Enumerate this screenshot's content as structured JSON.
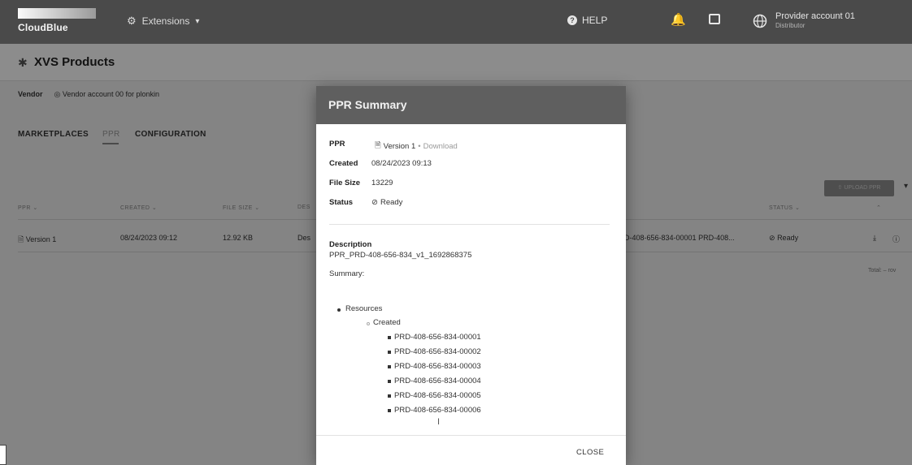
{
  "topbar": {
    "logo_text": "CloudBlue",
    "extensions_label": "Extensions",
    "help_label": "HELP",
    "account_name": "Provider account 01",
    "account_role": "Distributor"
  },
  "page": {
    "title": "XVS Products"
  },
  "vendor": {
    "label": "Vendor",
    "value": "Vendor account 00 for plonkin"
  },
  "tabs": [
    {
      "label": "MARKETPLACES"
    },
    {
      "label": "PPR"
    },
    {
      "label": "CONFIGURATION"
    }
  ],
  "upload_button": {
    "label": "⇧ UPLOAD PPR"
  },
  "table": {
    "headers": [
      "PPR ⌄",
      "CREATED ⌄",
      "FILE SIZE ⌄",
      "DES",
      "STATUS ⌄",
      "⌃"
    ],
    "rows": [
      {
        "ppr": "Version 1",
        "created": "08/24/2023 09:12",
        "file_size": "12.92 KB",
        "description": "Des",
        "resources": "D-408-656-834-00001 PRD-408...",
        "status": "Ready"
      }
    ],
    "total": "Total: – rov"
  },
  "modal": {
    "title": "PPR Summary",
    "ppr_label": "PPR",
    "ppr_version": "Version 1",
    "ppr_sep": "•",
    "ppr_download": "Download",
    "created_label": "Created",
    "created_value": "08/24/2023 09:13",
    "file_size_label": "File Size",
    "file_size_value": "13229",
    "status_label": "Status",
    "status_value": "Ready",
    "description_label": "Description",
    "description_value": "PPR_PRD-408-656-834_v1_1692868375",
    "summary_label": "Summary:",
    "resources_label": "Resources",
    "created_group_label": "Created",
    "items": [
      "PRD-408-656-834-00001",
      "PRD-408-656-834-00002",
      "PRD-408-656-834-00003",
      "PRD-408-656-834-00004",
      "PRD-408-656-834-00005",
      "PRD-408-656-834-00006"
    ],
    "close_label": "CLOSE"
  }
}
